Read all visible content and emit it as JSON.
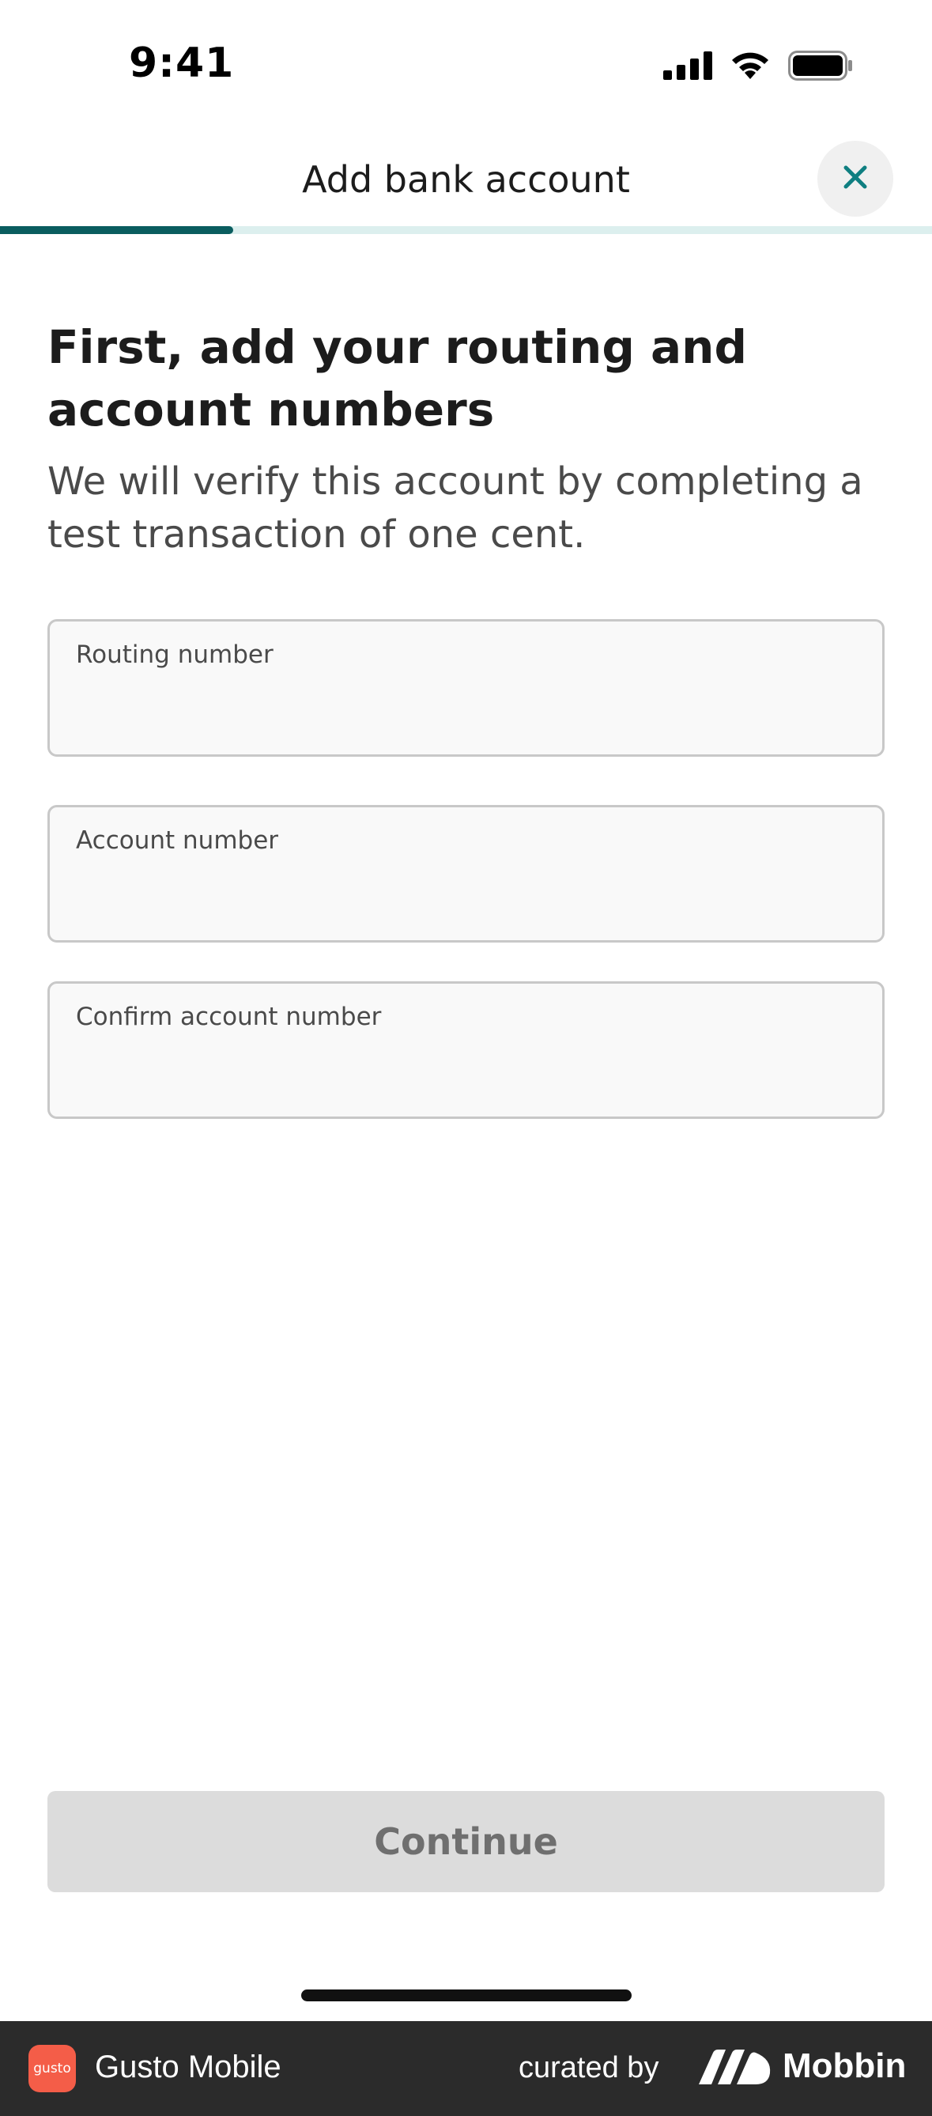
{
  "status_bar": {
    "time": "9:41",
    "icons": [
      "cellular-signal-icon",
      "wifi-icon",
      "battery-icon"
    ]
  },
  "header": {
    "title": "Add bank account",
    "close_icon": "close-icon",
    "progress_fraction": 0.25
  },
  "content": {
    "heading": "First, add your routing and account numbers",
    "subtext": "We will verify this account by completing a test transaction of one cent."
  },
  "form": {
    "fields": [
      {
        "label": "Routing number",
        "value": ""
      },
      {
        "label": "Account number",
        "value": ""
      },
      {
        "label": "Confirm account number",
        "value": ""
      }
    ],
    "submit_label": "Continue"
  },
  "footer": {
    "brand_logo_text": "gusto",
    "brand_name": "Gusto Mobile",
    "curated_by": "curated by",
    "mobbin_name": "Mobbin"
  },
  "colors": {
    "accent_teal": "#0a5d5f",
    "close_icon": "#0f7f81",
    "progress_track": "#dcefee",
    "button_disabled": "#dcdcdc",
    "footer_bg": "#2b2b2b",
    "brand_orange": "#f45d48"
  }
}
